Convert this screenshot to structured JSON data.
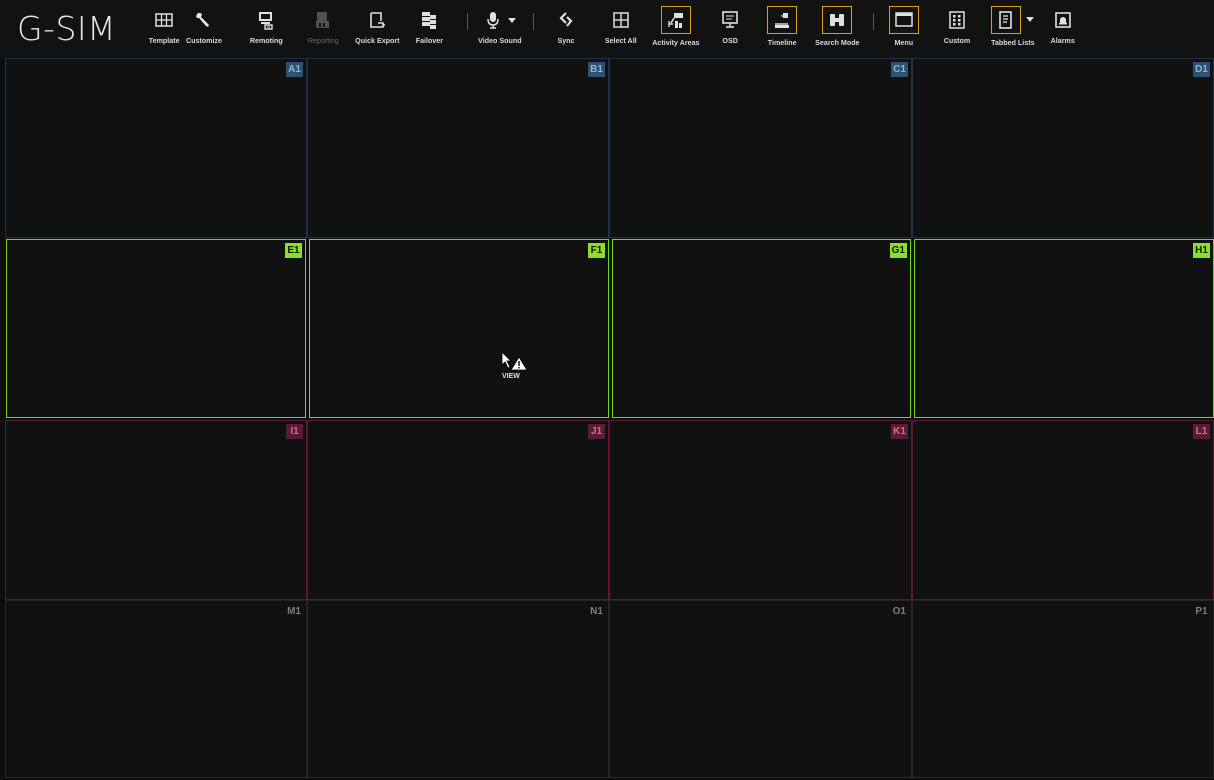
{
  "app": {
    "logo": "G-SIM"
  },
  "toolbar": {
    "template": "Template",
    "customize": "Customize",
    "remoting": "Remoting",
    "reporting": "Reporting",
    "quick_export": "Quick Export",
    "failover": "Failover",
    "video_sound": "Video Sound",
    "sync": "Sync",
    "select_all": "Select All",
    "activity_areas": "Activity Areas",
    "osd": "OSD",
    "timeline": "Timeline",
    "search_mode": "Search Mode",
    "menu": "Menu",
    "custom": "Custom",
    "tabbed_lists": "Tabbed Lists",
    "alarms": "Alarms"
  },
  "colors": {
    "highlight_border": "#d6a11a",
    "group_blue": "#2c5273",
    "group_green": "#8de01f",
    "group_red": "#5c1a36",
    "group_gray": "#7d7d7d"
  },
  "tiles": {
    "A1": "A1",
    "B1": "B1",
    "C1": "C1",
    "D1": "D1",
    "E1": "E1",
    "F1": "F1",
    "G1": "G1",
    "H1": "H1",
    "I1": "I1",
    "J1": "J1",
    "K1": "K1",
    "L1": "L1",
    "M1": "M1",
    "N1": "N1",
    "O1": "O1",
    "P1": "P1"
  },
  "cursor": {
    "label": "VIEW"
  }
}
